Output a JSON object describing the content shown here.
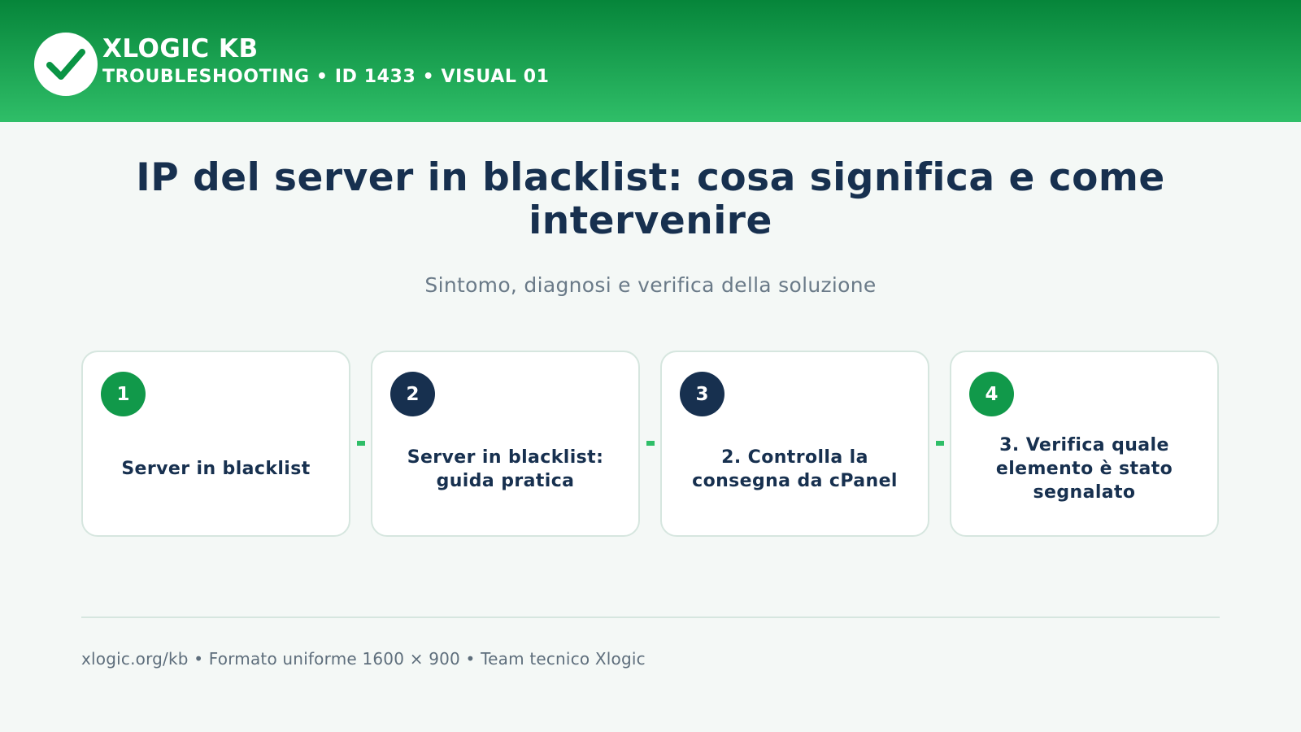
{
  "header": {
    "brand": "XLOGIC KB",
    "subtitle": "TROUBLESHOOTING • ID 1433 • VISUAL 01",
    "logo_icon": "checkmark-icon",
    "gradient_top": "#06853a",
    "gradient_bottom": "#2fbe68"
  },
  "main": {
    "title": "IP del server in blacklist: cosa significa e come intervenire",
    "subtitle": "Sintomo, diagnosi e verifica della soluzione"
  },
  "steps": [
    {
      "number": "1",
      "label": "Server in blacklist",
      "badge_color": "#11994a"
    },
    {
      "number": "2",
      "label": "Server in blacklist: guida pratica",
      "badge_color": "#17304f"
    },
    {
      "number": "3",
      "label": "2. Controlla la consegna da cPanel",
      "badge_color": "#17304f"
    },
    {
      "number": "4",
      "label": "3. Verifica quale elemento è stato segnalato",
      "badge_color": "#11994a"
    }
  ],
  "footer": {
    "text": "xlogic.org/kb • Formato uniforme 1600 × 900 • Team tecnico Xlogic"
  },
  "colors": {
    "accent_green": "#2fbe68",
    "navy": "#17304f",
    "background": "#f4f8f6"
  }
}
